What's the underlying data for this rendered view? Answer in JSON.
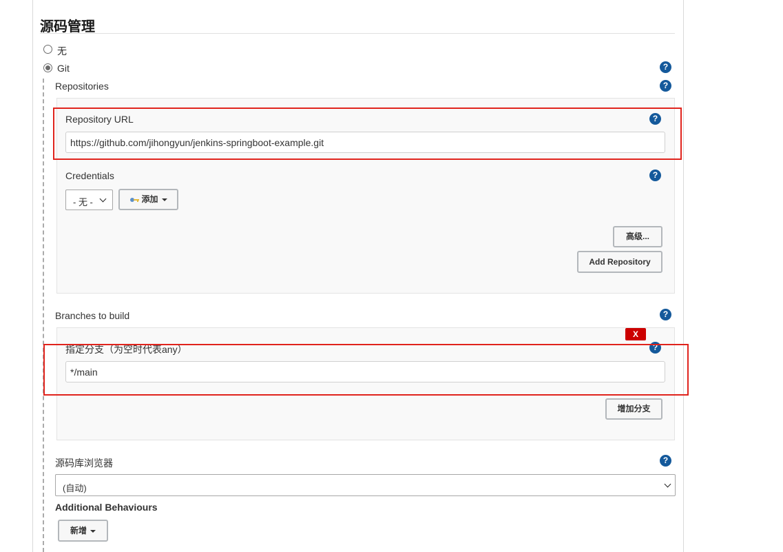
{
  "section": {
    "title": "源码管理"
  },
  "scm": {
    "options": [
      {
        "label": "无",
        "checked": false
      },
      {
        "label": "Git",
        "checked": true
      }
    ]
  },
  "help_glyph": "?",
  "repositories": {
    "label": "Repositories",
    "url_label": "Repository URL",
    "url_value": "https://github.com/jihongyun/jenkins-springboot-example.git",
    "credentials_label": "Credentials",
    "credentials_selected": "- 无 -",
    "add_label": "添加",
    "advanced_label": "高级...",
    "add_repository_label": "Add Repository"
  },
  "branches": {
    "label": "Branches to build",
    "spec_label": "指定分支（为空时代表any）",
    "spec_value": "*/main",
    "delete_label": "X",
    "add_branch_label": "增加分支"
  },
  "browser": {
    "label": "源码库浏览器",
    "selected": "(自动)"
  },
  "behaviours": {
    "label": "Additional Behaviours",
    "add_label": "新增"
  },
  "colors": {
    "help": "#14599b",
    "highlight": "#e0231c",
    "delete": "#cc0000"
  }
}
